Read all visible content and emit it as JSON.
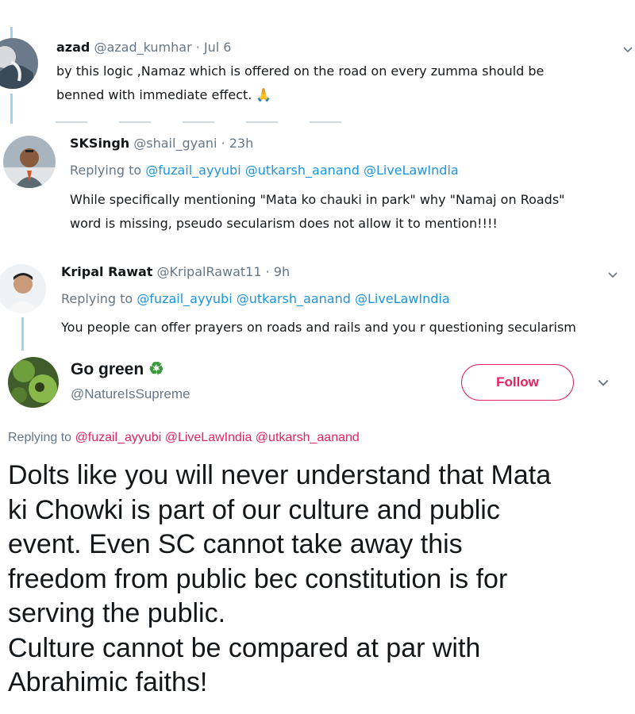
{
  "tweets": [
    {
      "name": "azad",
      "handle": "@azad_kumhar",
      "date": "· Jul 6",
      "text_lines": [
        "by this logic ,Namaz which is offered on the road on every zumma should be",
        "benned with immediate effect. 🙏"
      ]
    },
    {
      "name": "SKSingh",
      "handle": "@shail_gyani",
      "date": "· 23h",
      "replying_prefix": "Replying to",
      "replying_to": [
        "@fuzail_ayyubi",
        "@utkarsh_aanand",
        "@LiveLawIndia"
      ],
      "text_lines": [
        "While specifically mentioning \"Mata ko chauki in park\" why \"Namaj on Roads\"",
        "word is missing, pseudo secularism does not allow it to mention!!!!"
      ]
    },
    {
      "name": "Kripal Rawat",
      "handle": "@KripalRawat11",
      "date": "· 9h",
      "replying_prefix": "Replying to",
      "replying_to": [
        "@fuzail_ayyubi",
        "@utkarsh_aanand",
        "@LiveLawIndia"
      ],
      "text_lines": [
        "You people can offer prayers on roads and rails and you r questioning secularism"
      ]
    }
  ],
  "main_tweet": {
    "name": "Go green",
    "name_emoji": "♻",
    "handle": "@NatureIsSupreme",
    "follow_label": "Follow",
    "replying_prefix": "Replying to",
    "replying_to": [
      "@fuzail_ayyubi",
      "@LiveLawIndia",
      "@utkarsh_aanand"
    ],
    "text_lines": [
      "Dolts like you will never understand that Mata",
      "ki Chowki is part of our culture and public",
      "event. Even SC cannot take away this",
      "freedom from public bec constitution is for",
      "serving the public.",
      "Culture cannot be compared at par with",
      "Abrahimic faiths!"
    ]
  },
  "colors": {
    "link": "#1b95e0",
    "follow_accent": "#e0245e",
    "muted": "#657786",
    "thread_line": "#9fd3ee"
  }
}
